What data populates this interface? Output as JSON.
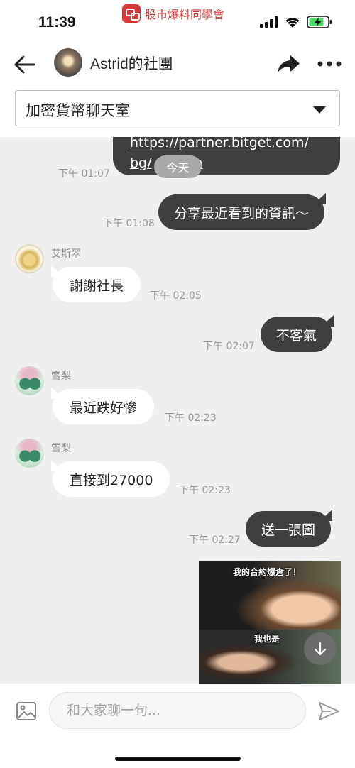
{
  "status_bar": {
    "time": "11:39",
    "app_name": "股市爆料同學會",
    "app_icon": "chat-bubbles-icon",
    "signal_icon": "cellular-signal-icon",
    "wifi_icon": "wifi-icon",
    "battery_icon": "battery-charging-icon",
    "battery_color": "#4cd964"
  },
  "header": {
    "back_icon": "arrow-left-icon",
    "title": "Astrid的社團",
    "share_icon": "share-arrow-icon",
    "more_icon": "more-dots-icon"
  },
  "room_selector": {
    "selected": "加密貨幣聊天室",
    "caret_icon": "caret-down-icon"
  },
  "chat": {
    "day_divider": "今天",
    "link_message": {
      "line1": "https://partner.bitget.com/",
      "line2": "bg/",
      "line2_tail": "n",
      "time": "下午 01:07"
    },
    "messages": [
      {
        "side": "out",
        "text": "分享最近看到的資訊～",
        "time": "下午 01:08"
      },
      {
        "side": "in",
        "sender": "艾斯翠",
        "avatar": "dog-avatar",
        "text": "謝謝社長",
        "time": "下午 02:05"
      },
      {
        "side": "out",
        "text": "不客氣",
        "time": "下午 02:07"
      },
      {
        "side": "in",
        "sender": "雪梨",
        "avatar": "pear-avatar",
        "text": "最近跌好慘",
        "time": "下午 02:23"
      },
      {
        "side": "in",
        "sender": "雪梨",
        "avatar": "pear-avatar",
        "text": "直接到27000",
        "time": "下午 02:23"
      },
      {
        "side": "out",
        "text": "送一張圖",
        "time": "下午 02:27"
      }
    ],
    "meme": {
      "caption_top": "我的合約爆倉了！",
      "caption_bottom": "我也是"
    },
    "scroll_down_icon": "arrow-down-icon"
  },
  "input_bar": {
    "image_icon": "image-picker-icon",
    "placeholder": "和大家聊一句...",
    "send_icon": "send-paper-plane-icon"
  },
  "colors": {
    "outgoing_bubble": "#3f3f3f",
    "incoming_bubble": "#ffffff",
    "chat_background": "#efefef",
    "brand": "#d43a3a"
  }
}
